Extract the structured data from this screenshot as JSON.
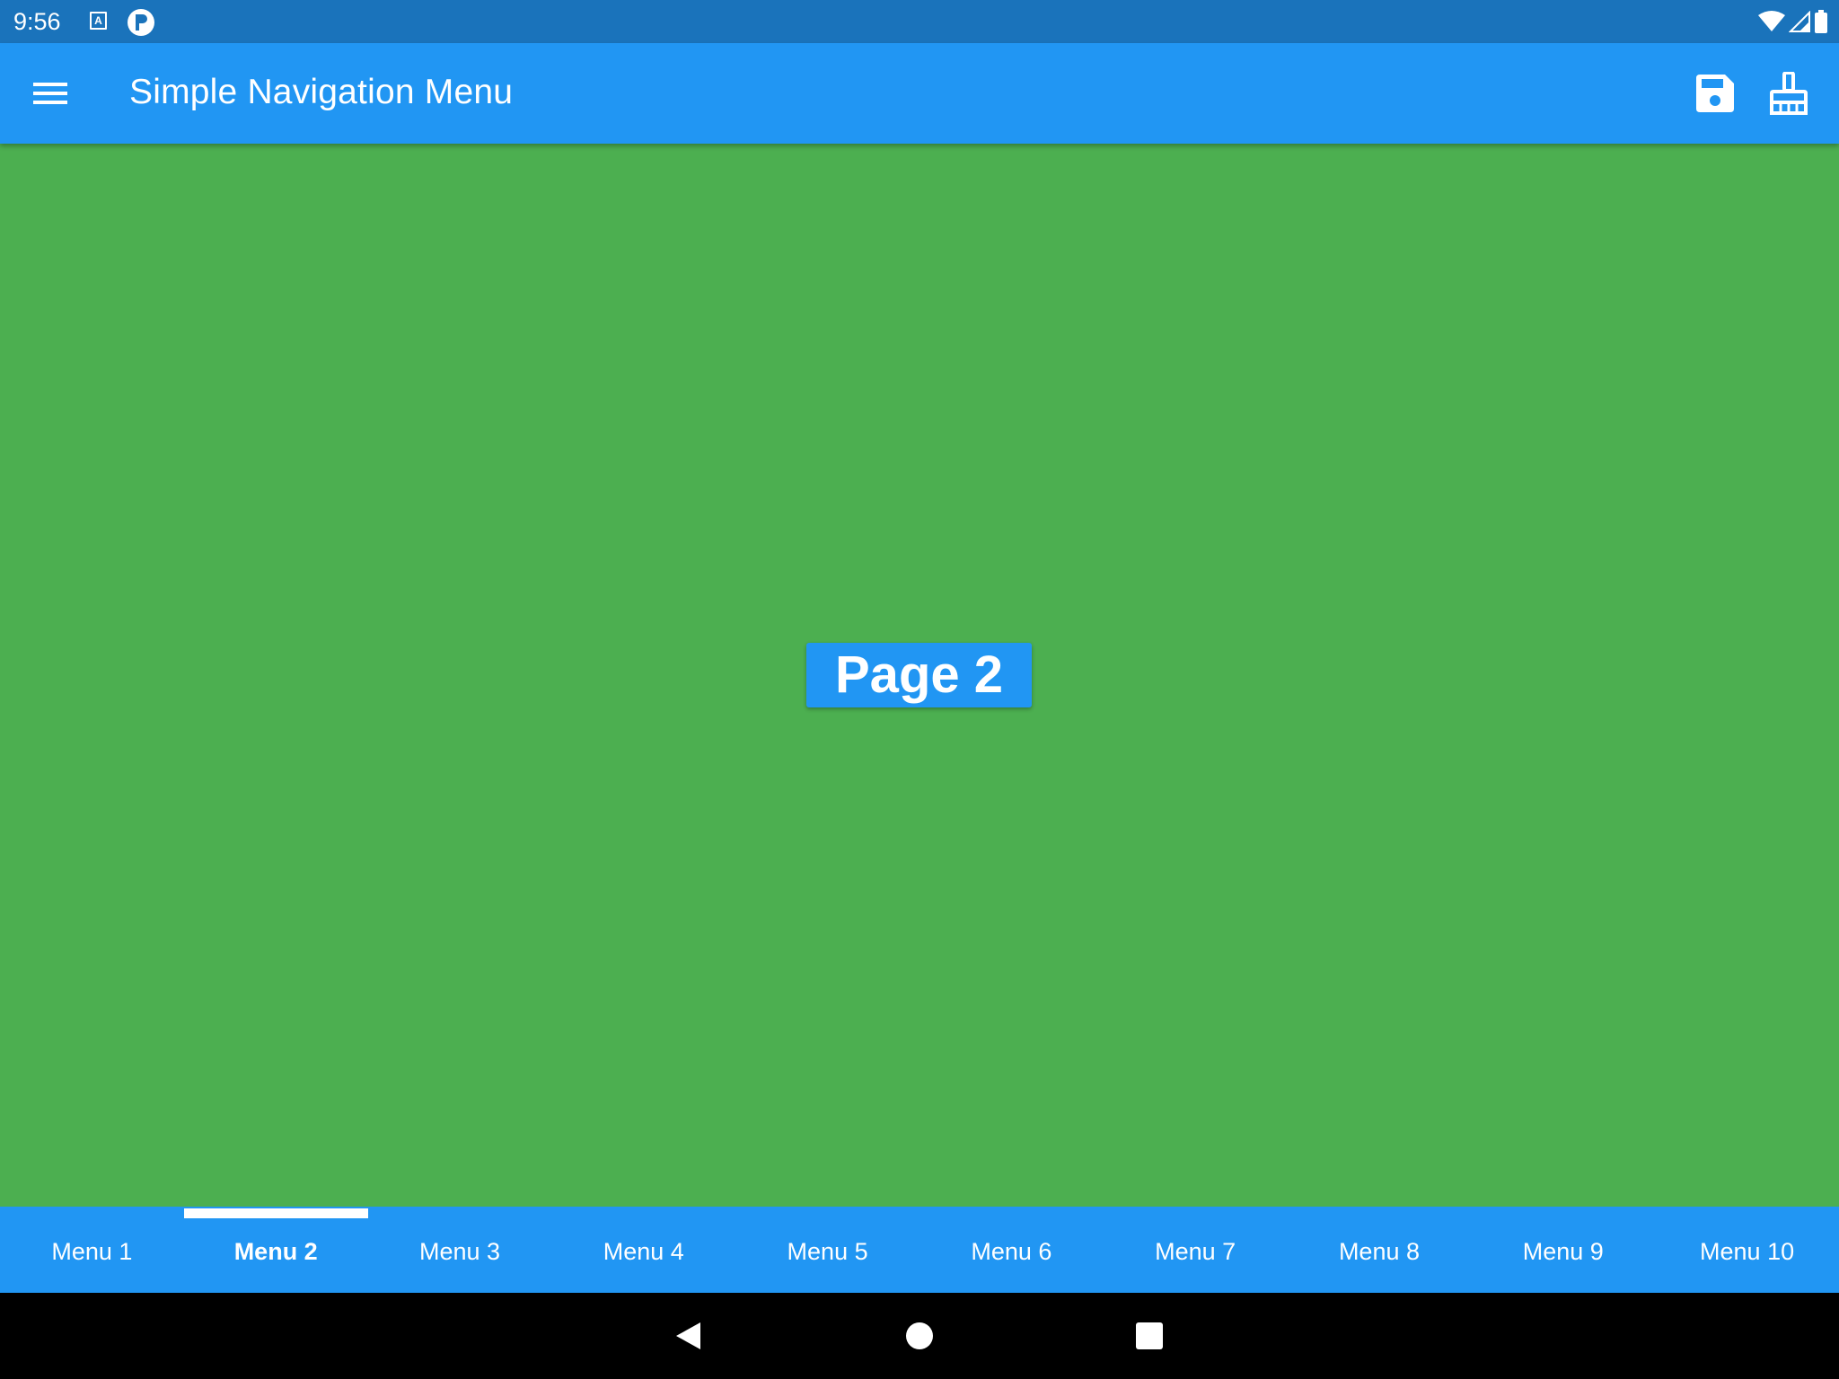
{
  "status_bar": {
    "time": "9:56",
    "icons": [
      "keyboard-a-icon",
      "p-app-icon",
      "wifi-icon",
      "signal-icon",
      "battery-icon"
    ]
  },
  "app_bar": {
    "title": "Simple Navigation Menu",
    "icons": [
      "menu-icon",
      "save-icon",
      "clean-icon"
    ]
  },
  "content": {
    "page_label": "Page 2",
    "background_color": "#4CAF50"
  },
  "tab_bar": {
    "active_index": 1,
    "tabs": [
      {
        "label": "Menu 1"
      },
      {
        "label": "Menu 2"
      },
      {
        "label": "Menu 3"
      },
      {
        "label": "Menu 4"
      },
      {
        "label": "Menu 5"
      },
      {
        "label": "Menu 6"
      },
      {
        "label": "Menu 7"
      },
      {
        "label": "Menu 8"
      },
      {
        "label": "Menu 9"
      },
      {
        "label": "Menu 10"
      }
    ]
  },
  "nav_bar": {
    "icons": [
      "back-icon",
      "home-icon",
      "recent-apps-icon"
    ]
  },
  "colors": {
    "status_bar": "#1A73BB",
    "primary": "#2196F3",
    "content": "#4CAF50",
    "nav_bar": "#000000"
  }
}
